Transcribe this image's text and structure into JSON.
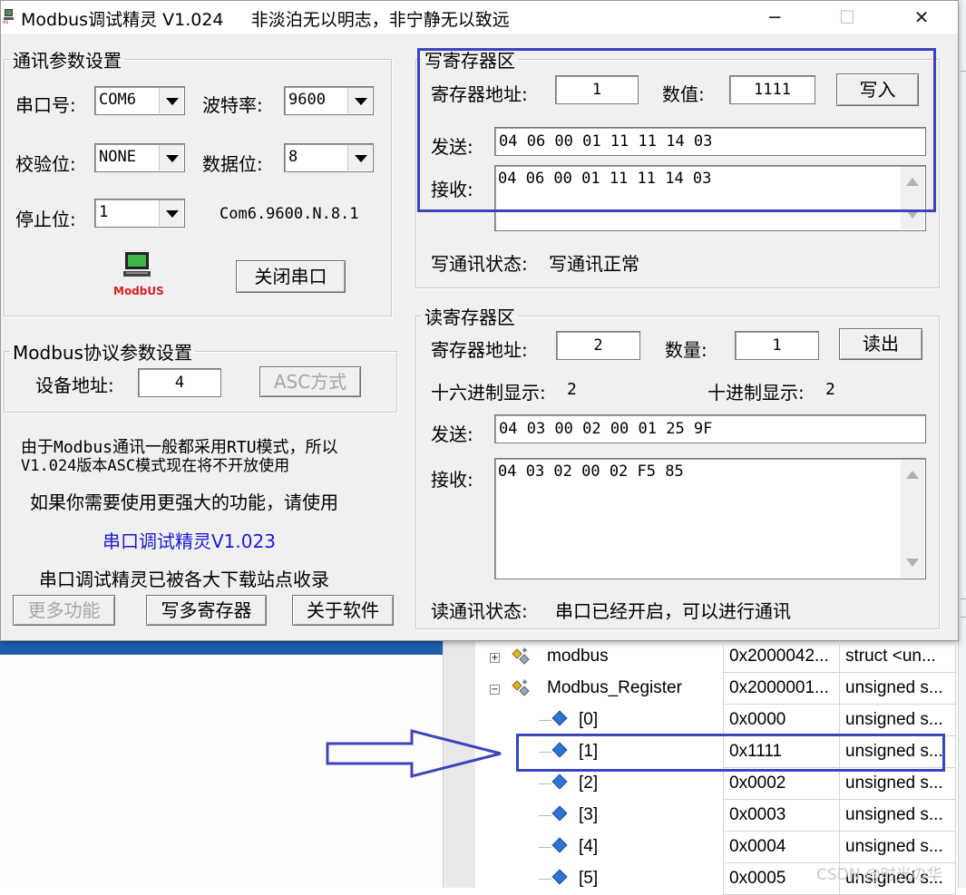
{
  "window": {
    "title": "Modbus调试精灵 V1.024     非淡泊无以明志，非宁静无以致远",
    "minimize": "─",
    "maximize": "☐",
    "close": "✕"
  },
  "comm": {
    "legend": "通讯参数设置",
    "port_label": "串口号:",
    "port_value": "COM6",
    "baud_label": "波特率:",
    "baud_value": "9600",
    "parity_label": "校验位:",
    "parity_value": "NONE",
    "databits_label": "数据位:",
    "databits_value": "8",
    "stopbits_label": "停止位:",
    "stopbits_value": "1",
    "summary": "Com6.9600.N.8.1",
    "logo_text": "ModbUS",
    "close_port_button": "关闭串口"
  },
  "protocol": {
    "legend": "Modbus协议参数设置",
    "device_label": "设备地址:",
    "device_value": "4",
    "asc_button": "ASC方式"
  },
  "info": {
    "line1": "由于Modbus通讯一般都采用RTU模式，所以",
    "line2": "V1.024版本ASC模式现在将不开放使用",
    "line3": "如果你需要使用更强大的功能，请使用",
    "link": "串口调试精灵V1.023",
    "line4": "串口调试精灵已被各大下载站点收录"
  },
  "bottom_buttons": {
    "more": "更多功能",
    "write_multi": "写多寄存器",
    "about": "关于软件"
  },
  "write": {
    "legend": "写寄存器区",
    "addr_label": "寄存器地址:",
    "addr_value": "1",
    "value_label": "数值:",
    "value_value": "1111",
    "write_button": "写入",
    "send_label": "发送:",
    "send_value": "04 06 00 01 11 11 14 03",
    "recv_label": "接收:",
    "recv_value": "04 06 00 01 11 11 14 03",
    "status_label": "写通讯状态:",
    "status_value": "写通讯正常"
  },
  "read": {
    "legend": "读寄存器区",
    "addr_label": "寄存器地址:",
    "addr_value": "2",
    "count_label": "数量:",
    "count_value": "1",
    "read_button": "读出",
    "hex_label": "十六进制显示:",
    "hex_value": "2",
    "dec_label": "十进制显示:",
    "dec_value": "2",
    "send_label": "发送:",
    "send_value": "04 03 00 02 00 01 25 9F",
    "recv_label": "接收:",
    "recv_value": "04 03 02 00 02 F5 85",
    "status_label": "读通讯状态:",
    "status_value": "串口已经开启，可以进行通讯"
  },
  "watch": {
    "rows": [
      {
        "name": "modbus",
        "value": "0x2000042...",
        "type": "struct <un...",
        "kind": "struct",
        "expander": "+"
      },
      {
        "name": "Modbus_Register",
        "value": "0x2000001...",
        "type": "unsigned s...",
        "kind": "struct",
        "expander": "−"
      },
      {
        "name": "[0]",
        "value": "0x0000",
        "type": "unsigned s...",
        "kind": "item"
      },
      {
        "name": "[1]",
        "value": "0x1111",
        "type": "unsigned s...",
        "kind": "item"
      },
      {
        "name": "[2]",
        "value": "0x0002",
        "type": "unsigned s...",
        "kind": "item"
      },
      {
        "name": "[3]",
        "value": "0x0003",
        "type": "unsigned s...",
        "kind": "item"
      },
      {
        "name": "[4]",
        "value": "0x0004",
        "type": "unsigned s...",
        "kind": "item"
      },
      {
        "name": "[5]",
        "value": "0x0005",
        "type": "unsigned s...",
        "kind": "item"
      }
    ]
  },
  "watermark": "CSDN @时光の华",
  "colors": {
    "highlight": "#3a44bf",
    "link": "#1a1adc",
    "logo_red": "#d62020"
  }
}
